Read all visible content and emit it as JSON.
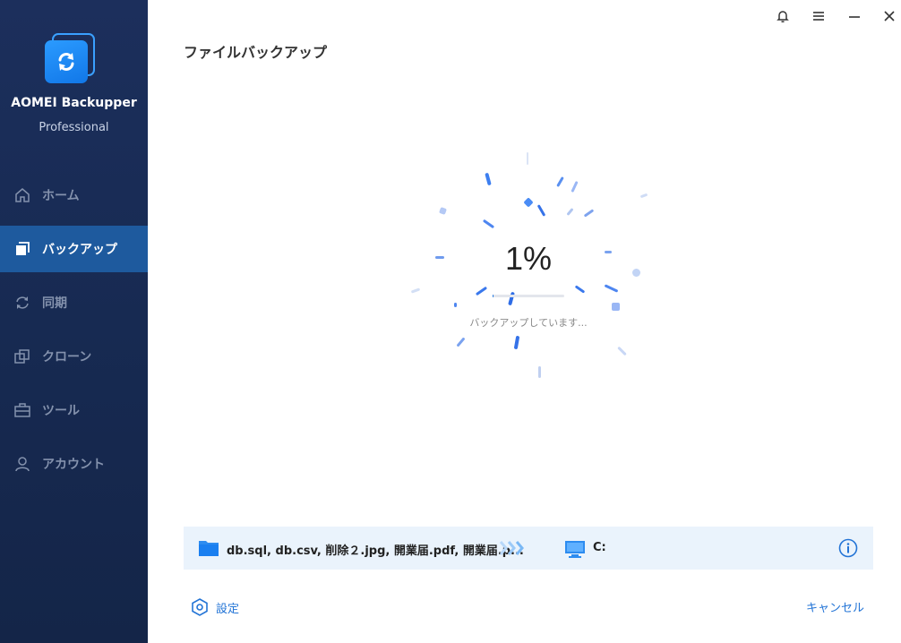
{
  "app": {
    "name": "AOMEI Backupper",
    "edition": "Professional",
    "brand_color": "#1a7ff0",
    "sidebar_bg": "#172a52",
    "active_bg": "#1e5a9e"
  },
  "sidebar": {
    "items": [
      {
        "label": "ホーム",
        "icon": "home-icon",
        "active": false
      },
      {
        "label": "バックアップ",
        "icon": "backup-icon",
        "active": true
      },
      {
        "label": "同期",
        "icon": "sync-icon",
        "active": false
      },
      {
        "label": "クローン",
        "icon": "clone-icon",
        "active": false
      },
      {
        "label": "ツール",
        "icon": "toolbox-icon",
        "active": false
      },
      {
        "label": "アカウント",
        "icon": "user-icon",
        "active": false
      }
    ]
  },
  "window_controls": [
    "bell-icon",
    "menu-icon",
    "minimize-icon",
    "close-icon"
  ],
  "main": {
    "title": "ファイルバックアップ",
    "progress": {
      "percent_text": "1%",
      "value": 0.01,
      "status": "バックアップしています..."
    },
    "info_bar": {
      "source": "db.sql, db.csv, 削除２.jpg, 開業届.pdf, 開業届.p...",
      "destination": "C:"
    },
    "actions": {
      "settings_label": "設定",
      "cancel_label": "キャンセル"
    }
  }
}
